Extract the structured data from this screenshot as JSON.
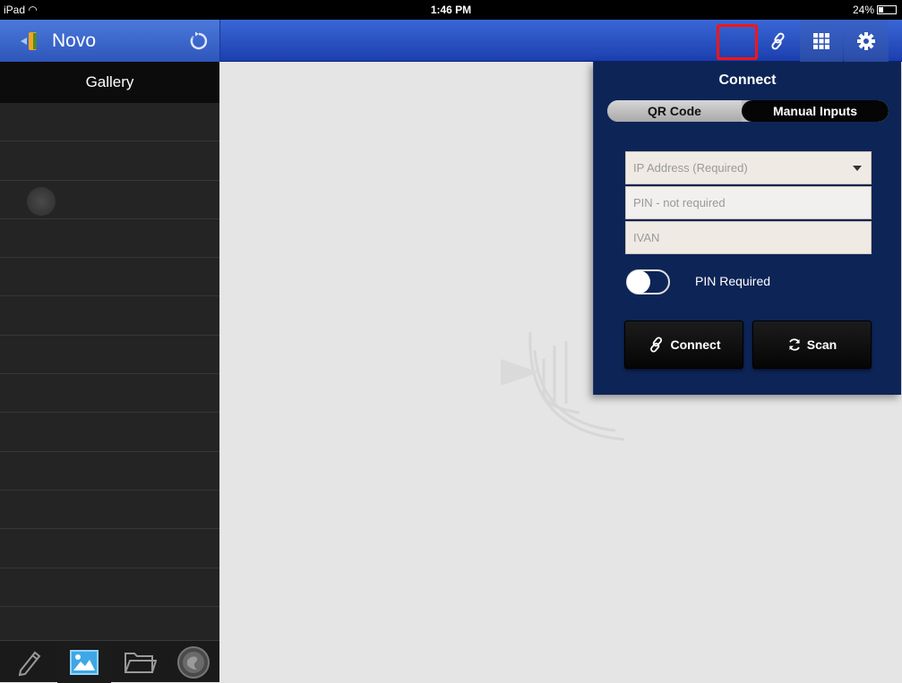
{
  "status_bar": {
    "device": "iPad",
    "time": "1:46 PM",
    "battery": "24%"
  },
  "app": {
    "title": "Novo"
  },
  "toolbar": {
    "icons": [
      "refresh-icon",
      "link-icon",
      "grid-icon",
      "gear-icon"
    ]
  },
  "sidebar": {
    "header": "Gallery",
    "bottom_icons": [
      "pencil-icon",
      "gallery-icon",
      "folder-icon",
      "globe-icon"
    ]
  },
  "connect_popover": {
    "title": "Connect",
    "tabs": [
      {
        "label": "QR Code",
        "selected": false
      },
      {
        "label": "Manual Inputs",
        "selected": true
      }
    ],
    "ip_placeholder": "IP Address (Required)",
    "pin_placeholder": "PIN - not required",
    "name_value": "IVAN",
    "pin_toggle_label": "PIN Required",
    "pin_toggle_on": false,
    "connect_label": "Connect",
    "scan_label": "Scan"
  },
  "colors": {
    "toolbar_blue": "#2a52c2",
    "popover_bg": "#0d2456",
    "highlight_red": "#ff1414"
  }
}
